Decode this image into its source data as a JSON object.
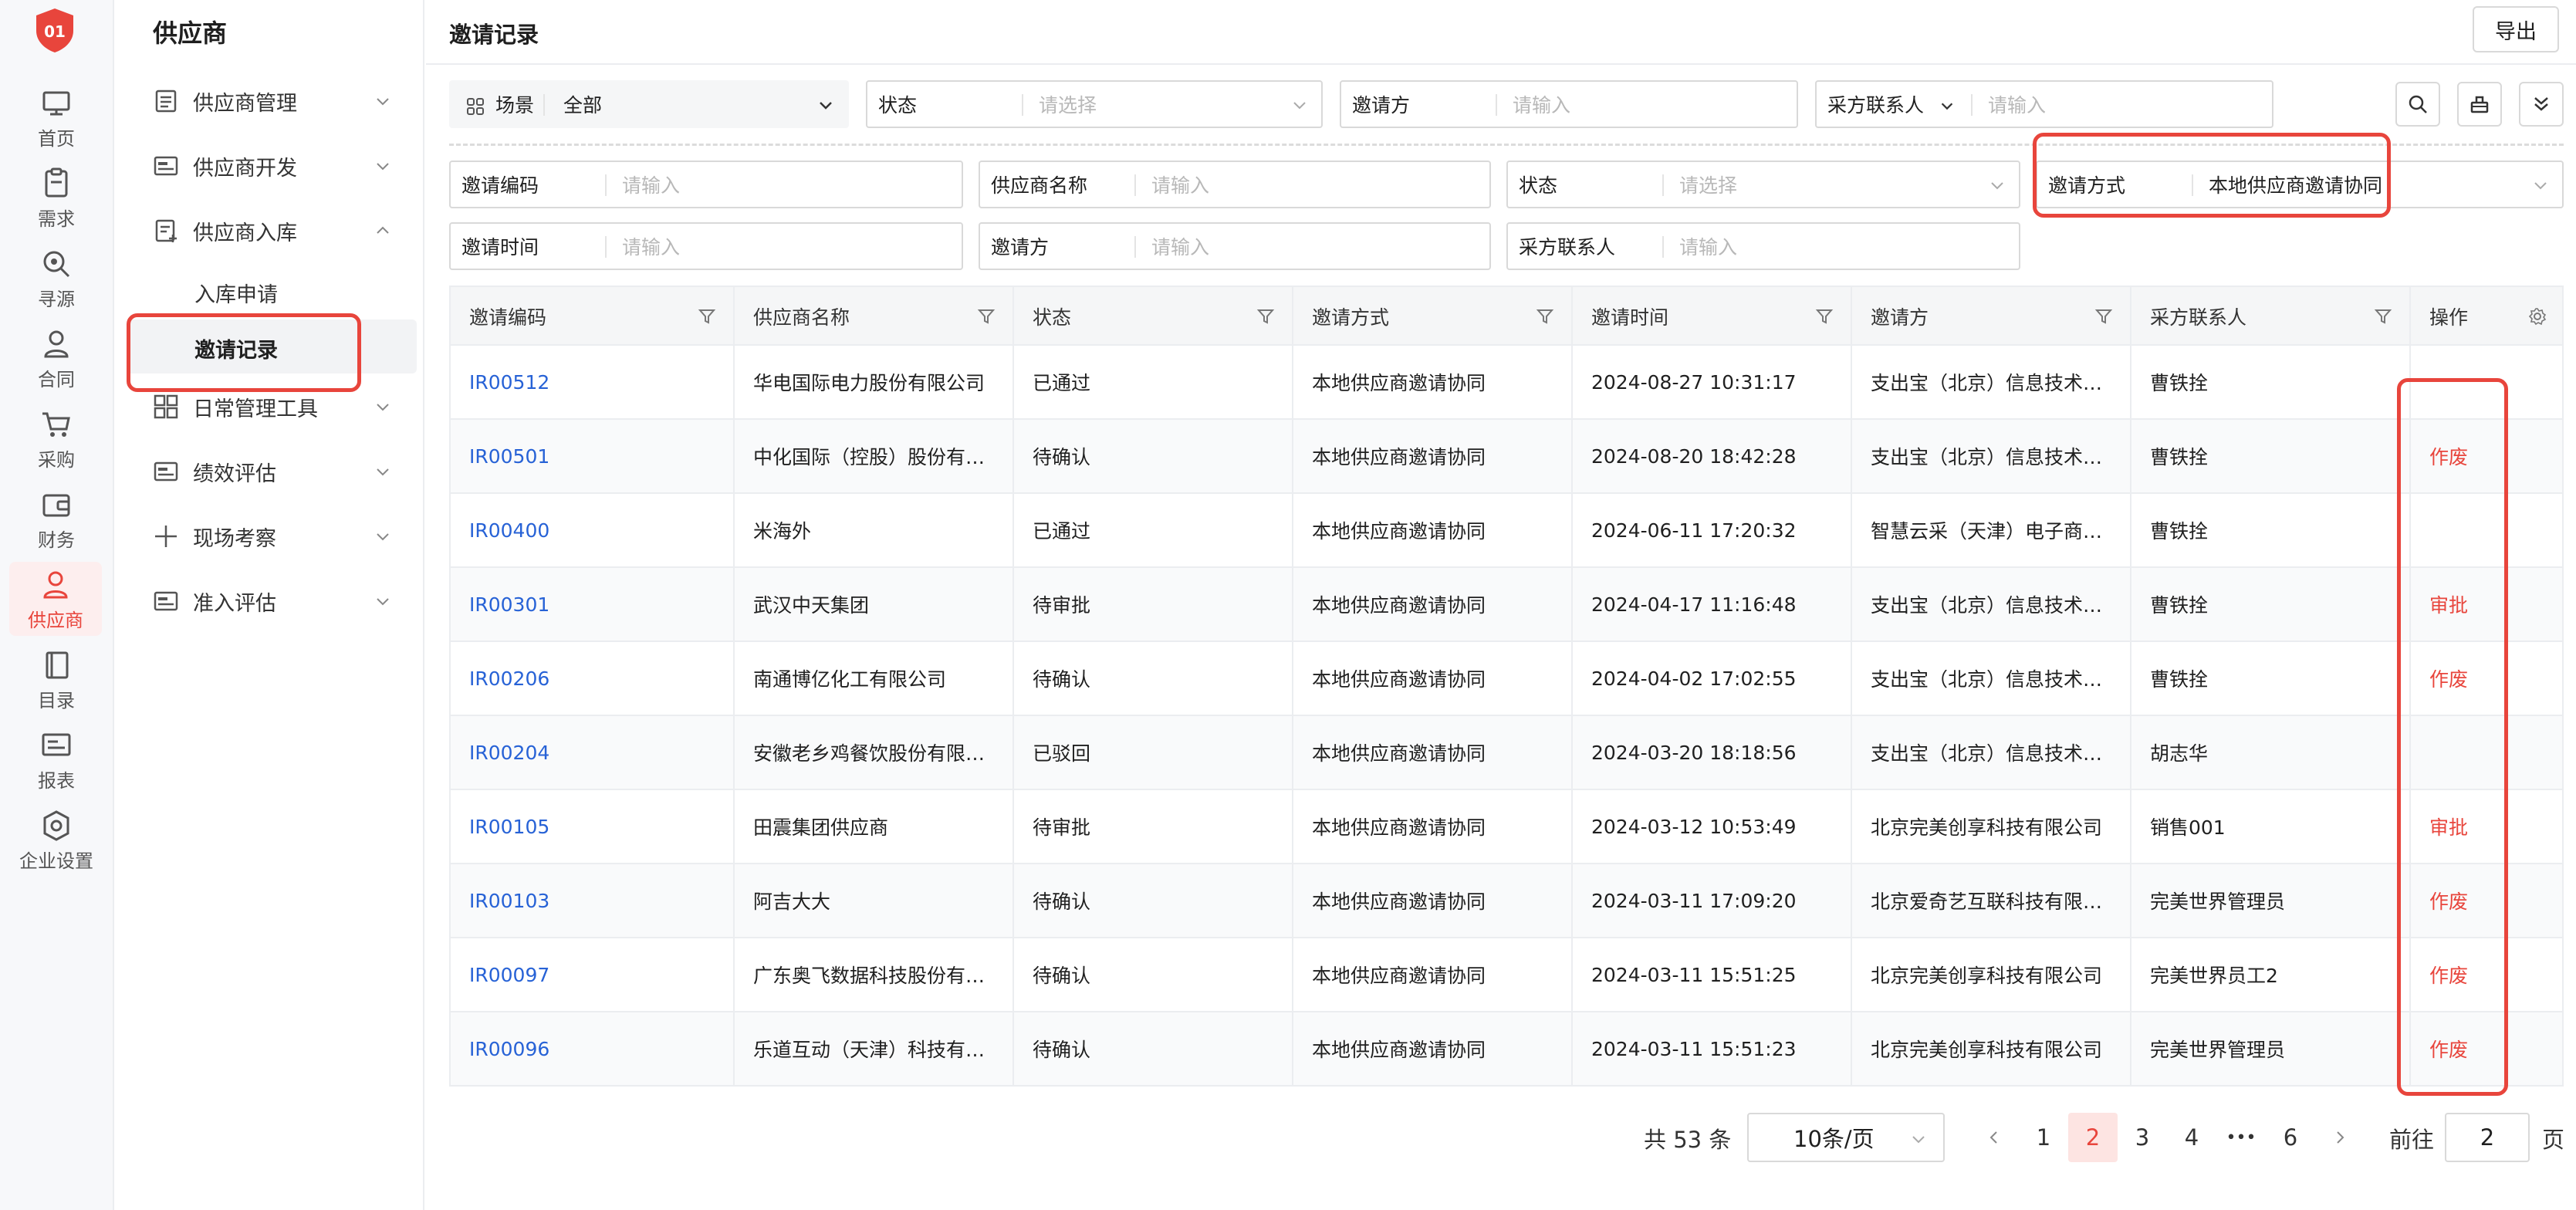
{
  "rail": {
    "items": [
      {
        "label": "首页",
        "icon": "home-icon"
      },
      {
        "label": "需求",
        "icon": "clipboard-icon"
      },
      {
        "label": "寻源",
        "icon": "search-icon"
      },
      {
        "label": "合同",
        "icon": "contract-icon"
      },
      {
        "label": "采购",
        "icon": "cart-icon"
      },
      {
        "label": "财务",
        "icon": "wallet-icon"
      },
      {
        "label": "供应商",
        "icon": "supplier-icon"
      },
      {
        "label": "目录",
        "icon": "catalog-icon"
      },
      {
        "label": "报表",
        "icon": "report-icon"
      },
      {
        "label": "企业设置",
        "icon": "settings-icon"
      }
    ],
    "active": "供应商",
    "logo_text": "01"
  },
  "nav": {
    "title": "供应商",
    "items": [
      {
        "label": "供应商管理"
      },
      {
        "label": "供应商开发"
      },
      {
        "label": "供应商入库",
        "expanded": true
      },
      {
        "label": "日常管理工具"
      },
      {
        "label": "绩效评估"
      },
      {
        "label": "现场考察"
      },
      {
        "label": "准入评估"
      }
    ],
    "sub_items": [
      {
        "label": "入库申请"
      },
      {
        "label": "邀请记录",
        "active": true
      }
    ]
  },
  "header": {
    "title": "邀请记录",
    "export_label": "导出"
  },
  "filters": {
    "scene_label": "场景",
    "scene_value": "全部",
    "row1": [
      {
        "label": "状态",
        "placeholder": "请选择"
      },
      {
        "label": "邀请方",
        "placeholder": "请输入"
      },
      {
        "label": "采方联系人",
        "placeholder": "请输入"
      }
    ],
    "row2": [
      {
        "label": "邀请编码",
        "placeholder": "请输入"
      },
      {
        "label": "供应商名称",
        "placeholder": "请输入"
      },
      {
        "label": "状态",
        "placeholder": "请选择"
      },
      {
        "label": "邀请方式",
        "value": "本地供应商邀请协同"
      }
    ],
    "row3": [
      {
        "label": "邀请时间",
        "placeholder": "请输入"
      },
      {
        "label": "邀请方",
        "placeholder": "请输入"
      },
      {
        "label": "采方联系人",
        "placeholder": "请输入"
      }
    ]
  },
  "table": {
    "columns": [
      "邀请编码",
      "供应商名称",
      "状态",
      "邀请方式",
      "邀请时间",
      "邀请方",
      "采方联系人",
      "操作"
    ],
    "rows": [
      {
        "code": "IR00512",
        "supplier": "华电国际电力股份有限公司",
        "status": "已通过",
        "method": "本地供应商邀请协同",
        "time": "2024-08-27 10:31:17",
        "inviter": "支出宝（北京）信息技术…",
        "contact": "曹铁拴",
        "action": ""
      },
      {
        "code": "IR00501",
        "supplier": "中化国际（控股）股份有…",
        "status": "待确认",
        "method": "本地供应商邀请协同",
        "time": "2024-08-20 18:42:28",
        "inviter": "支出宝（北京）信息技术…",
        "contact": "曹铁拴",
        "action": "作废"
      },
      {
        "code": "IR00400",
        "supplier": "米海外",
        "status": "已通过",
        "method": "本地供应商邀请协同",
        "time": "2024-06-11 17:20:32",
        "inviter": "智慧云采（天津）电子商…",
        "contact": "曹铁拴",
        "action": ""
      },
      {
        "code": "IR00301",
        "supplier": "武汉中天集团",
        "status": "待审批",
        "method": "本地供应商邀请协同",
        "time": "2024-04-17 11:16:48",
        "inviter": "支出宝（北京）信息技术…",
        "contact": "曹铁拴",
        "action": "审批"
      },
      {
        "code": "IR00206",
        "supplier": "南通博亿化工有限公司",
        "status": "待确认",
        "method": "本地供应商邀请协同",
        "time": "2024-04-02 17:02:55",
        "inviter": "支出宝（北京）信息技术…",
        "contact": "曹铁拴",
        "action": "作废"
      },
      {
        "code": "IR00204",
        "supplier": "安徽老乡鸡餐饮股份有限…",
        "status": "已驳回",
        "method": "本地供应商邀请协同",
        "time": "2024-03-20 18:18:56",
        "inviter": "支出宝（北京）信息技术…",
        "contact": "胡志华",
        "action": ""
      },
      {
        "code": "IR00105",
        "supplier": "田震集团供应商",
        "status": "待审批",
        "method": "本地供应商邀请协同",
        "time": "2024-03-12 10:53:49",
        "inviter": "北京完美创享科技有限公司",
        "contact": "销售001",
        "action": "审批"
      },
      {
        "code": "IR00103",
        "supplier": "阿吉大大",
        "status": "待确认",
        "method": "本地供应商邀请协同",
        "time": "2024-03-11 17:09:20",
        "inviter": "北京爱奇艺互联科技有限…",
        "contact": "完美世界管理员",
        "action": "作废"
      },
      {
        "code": "IR00097",
        "supplier": "广东奥飞数据科技股份有…",
        "status": "待确认",
        "method": "本地供应商邀请协同",
        "time": "2024-03-11 15:51:25",
        "inviter": "北京完美创享科技有限公司",
        "contact": "完美世界员工2",
        "action": "作废"
      },
      {
        "code": "IR00096",
        "supplier": "乐道互动（天津）科技有…",
        "status": "待确认",
        "method": "本地供应商邀请协同",
        "time": "2024-03-11 15:51:23",
        "inviter": "北京完美创享科技有限公司",
        "contact": "完美世界管理员",
        "action": "作废"
      }
    ]
  },
  "pagination": {
    "total": "共 53 条",
    "page_size": "10条/页",
    "pages": [
      "1",
      "2",
      "3",
      "4",
      "•••",
      "6"
    ],
    "current": "2",
    "goto_label": "前往",
    "goto_value": "2",
    "page_suffix": "页"
  },
  "colors": {
    "accent": "#e8453c",
    "link": "#2762d6",
    "border": "#d9d9d9"
  }
}
